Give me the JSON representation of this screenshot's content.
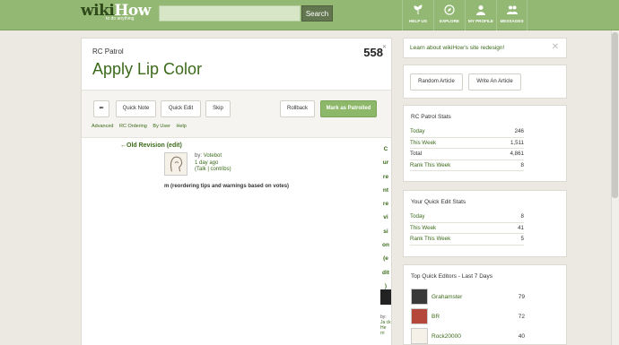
{
  "header": {
    "logo_main": "wiki",
    "logo_how": "How",
    "logo_tagline": "to do anything",
    "search_placeholder": "",
    "search_button": "Search",
    "nav": [
      {
        "label": "HELP US",
        "icon": "sprout-icon"
      },
      {
        "label": "EXPLORE",
        "icon": "compass-icon"
      },
      {
        "label": "MY PROFILE",
        "icon": "person-icon"
      },
      {
        "label": "MESSAGES",
        "icon": "messages-icon"
      }
    ]
  },
  "main": {
    "rc_title": "RC Patrol",
    "count": "558",
    "article_title": "Apply Lip Color",
    "toolbar": {
      "quick_note": "Quick Note",
      "quick_edit": "Quick Edit",
      "skip": "Skip",
      "rollback": "Rollback",
      "mark_patrolled": "Mark as Patrolled"
    },
    "sublinks": [
      "Advanced",
      "RC Ordering",
      "By User",
      "Help"
    ],
    "diff": {
      "old_revision": "←Old Revision (edit)",
      "by_label": "by:",
      "by_user": "Votebot",
      "time_ago": "1 day ago",
      "talk_contribs": "(Talk | contribs)",
      "edit_summary": "m (reordering tips and warnings based on votes)",
      "side_column": [
        "C",
        "ur",
        "re",
        "nt",
        "re",
        "vi",
        "si",
        "on",
        "(e",
        "dit",
        ")"
      ],
      "side_by": "by:",
      "side_user": "Ja ck He rri"
    }
  },
  "sidebar": {
    "banner": "Learn about wikiHow's site redesign!",
    "buttons": {
      "random": "Random Article",
      "write": "Write An Article"
    },
    "rc_stats": {
      "title": "RC Patrol Stats",
      "rows": [
        {
          "k": "Today",
          "v": "246"
        },
        {
          "k": "This Week",
          "v": "1,511"
        },
        {
          "k": "Total",
          "v": "4,861"
        },
        {
          "k": "Rank This Week",
          "v": "8"
        }
      ]
    },
    "quick_edit": {
      "title": "Your Quick Edit Stats",
      "rows": [
        {
          "k": "Today",
          "v": "8"
        },
        {
          "k": "This Week",
          "v": "41"
        },
        {
          "k": "Rank This Week",
          "v": "5"
        }
      ]
    },
    "top_editors": {
      "title": "Top Quick Editors - Last 7 Days",
      "rows": [
        {
          "name": "Grahamster",
          "count": "79"
        },
        {
          "name": "BR",
          "count": "72"
        },
        {
          "name": "Rock20000",
          "count": "40"
        }
      ]
    }
  },
  "colors": {
    "brand_green": "#93b874",
    "link_green": "#3b6a1a",
    "button_green": "#8db86a"
  }
}
